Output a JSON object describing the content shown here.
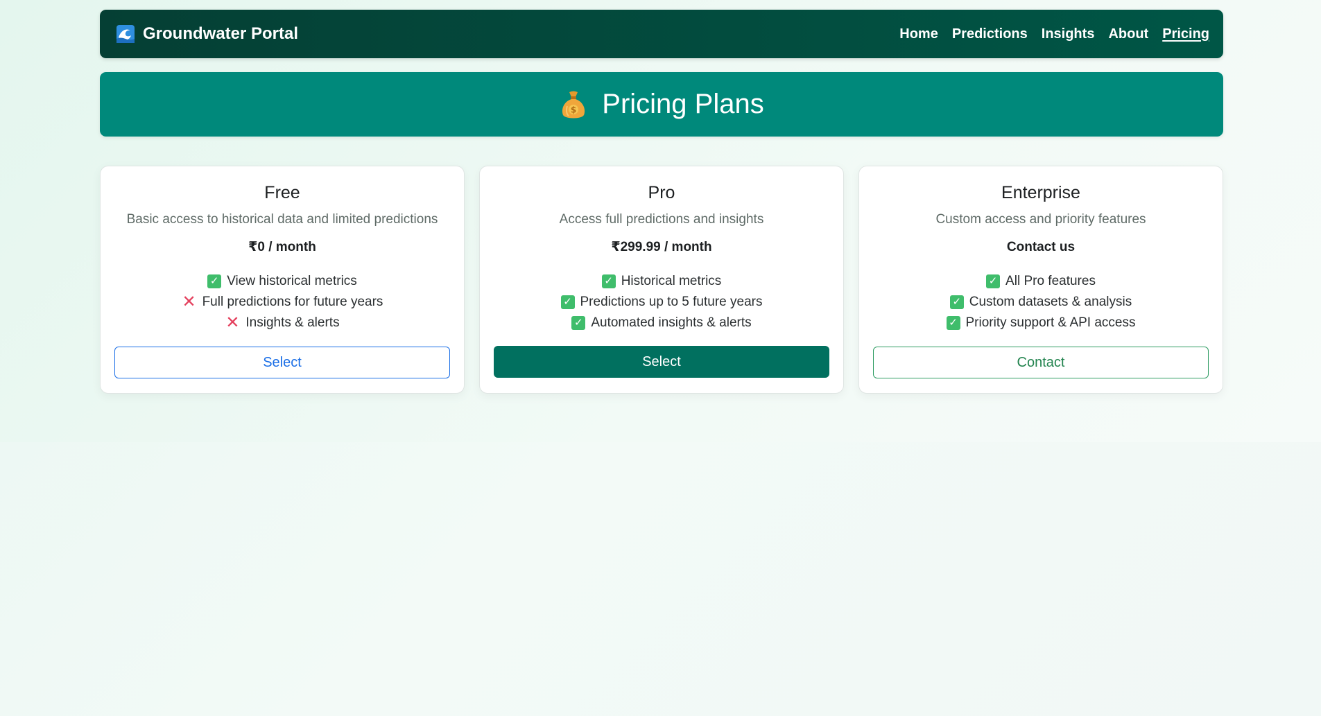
{
  "navbar": {
    "brand": "Groundwater Portal",
    "brand_icon": "wave-icon",
    "links": [
      {
        "label": "Home",
        "active": false
      },
      {
        "label": "Predictions",
        "active": false
      },
      {
        "label": "Insights",
        "active": false
      },
      {
        "label": "About",
        "active": false
      },
      {
        "label": "Pricing",
        "active": true
      }
    ],
    "colors": {
      "background": "#005646",
      "text": "#ffffff"
    }
  },
  "hero": {
    "title": "Pricing Plans",
    "icon": "money-bag-icon",
    "color": "#00897b"
  },
  "plans": [
    {
      "name": "Free",
      "description": "Basic access to historical data and limited predictions",
      "price": "₹0 / month",
      "features": [
        {
          "label": "View historical metrics",
          "included": true
        },
        {
          "label": "Full predictions for future years",
          "included": false
        },
        {
          "label": "Insights & alerts",
          "included": false
        }
      ],
      "button": "Select"
    },
    {
      "name": "Pro",
      "description": "Access full predictions and insights",
      "price": "₹299.99 / month",
      "features": [
        {
          "label": "Historical metrics",
          "included": true
        },
        {
          "label": "Predictions up to 5 future years",
          "included": true
        },
        {
          "label": "Automated insights & alerts",
          "included": true
        }
      ],
      "button": "Select"
    },
    {
      "name": "Enterprise",
      "description": "Custom access and priority features",
      "price": "Contact us",
      "features": [
        {
          "label": "All Pro features",
          "included": true
        },
        {
          "label": "Custom datasets & analysis",
          "included": true
        },
        {
          "label": "Priority support & API access",
          "included": true
        }
      ],
      "button": "Contact"
    }
  ],
  "colors": {
    "check": "#3fbd6b",
    "cross": "#e4405d",
    "select_outline": "#1a6ee6",
    "select_solid": "#01705f",
    "contact_outline": "#2c9b61"
  }
}
